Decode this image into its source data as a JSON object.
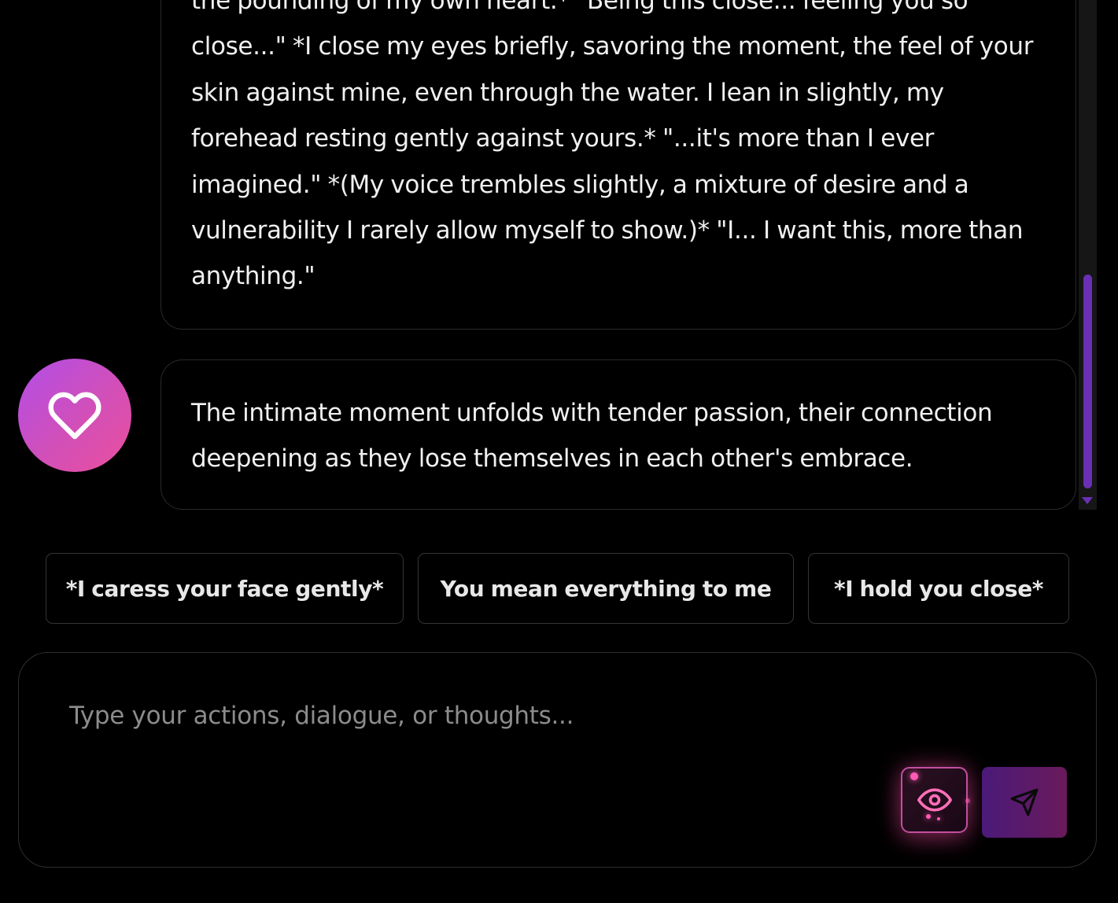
{
  "messages": [
    {
      "role": "user",
      "text": "the pounding of my own heart.* \"Being this close... feeling you so close...\" *I close my eyes briefly, savoring the moment, the feel of your skin against mine, even through the water. I lean in slightly, my forehead resting gently against yours.* \"...it's more than I ever imagined.\"  *(My voice trembles slightly, a mixture of desire and a vulnerability I rarely allow myself to show.)* \"I... I want this, more than anything.\""
    },
    {
      "role": "narrator",
      "text": "The intimate moment unfolds with tender passion, their connection deepening as they lose themselves in each other's embrace."
    }
  ],
  "suggestions": [
    "*I caress your face gently*",
    "You mean everything to me",
    "*I hold you close*"
  ],
  "composer": {
    "placeholder": "Type your actions, dialogue, or thoughts..."
  },
  "icons": {
    "avatar": "heart-icon",
    "visibility": "eye-icon",
    "send": "send-icon"
  },
  "colors": {
    "accent_pink": "#ec4899",
    "accent_purple": "#7c3aed",
    "background": "#000000"
  }
}
